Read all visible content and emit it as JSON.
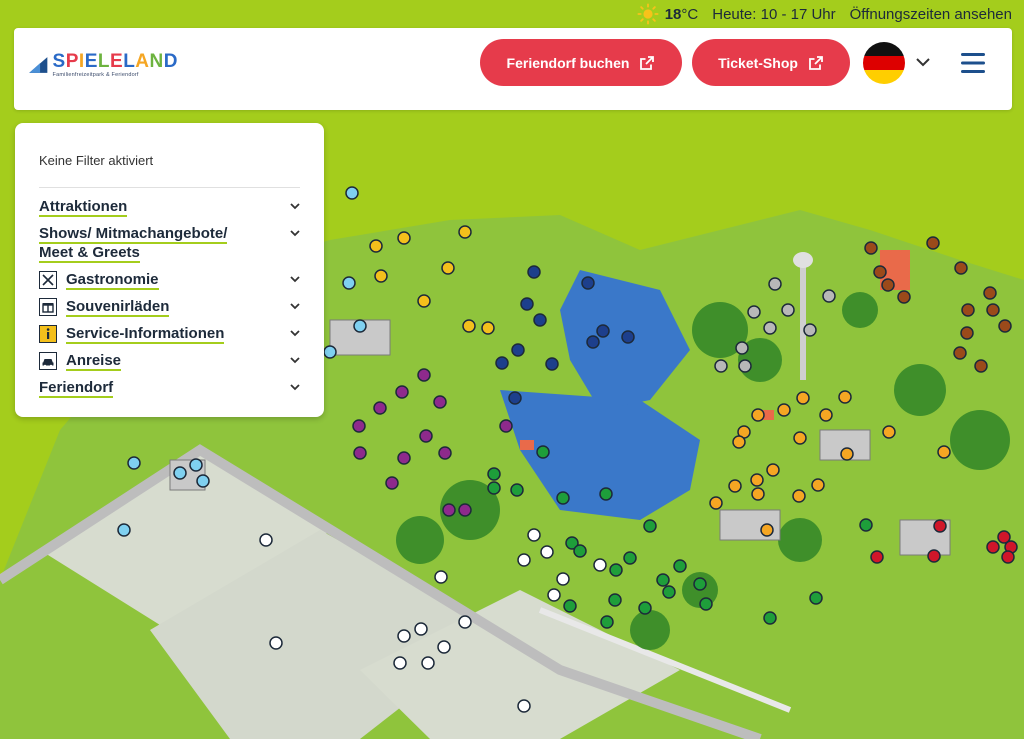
{
  "topbar": {
    "temperature": "18",
    "temperature_unit": "°C",
    "hours": "Heute: 10 - 17 Uhr",
    "hours_link": "Öffnungszeiten ansehen"
  },
  "header": {
    "logo_word": "SPIELELAND",
    "logo_sub": "Familienfreizeitpark & Feriendorf",
    "btn_feriendorf": "Feriendorf buchen",
    "btn_ticket": "Ticket-Shop",
    "language_icon": "flag-germany-icon",
    "colors": {
      "accent_red": "#e63b4b",
      "navy": "#1d4f8c",
      "lime": "#a4cd1c"
    }
  },
  "filter": {
    "status": "Keine Filter aktiviert",
    "items": [
      {
        "label": "Attraktionen",
        "icon": null
      },
      {
        "label": "Shows/ Mitmachangebote/",
        "label2": "Meet & Greets",
        "icon": null
      },
      {
        "label": "Gastronomie",
        "icon": "fork-knife-icon"
      },
      {
        "label": "Souvenirläden",
        "icon": "gift-icon"
      },
      {
        "label": "Service-Informationen",
        "icon": "info-icon"
      },
      {
        "label": "Anreise",
        "icon": "car-icon"
      },
      {
        "label": "Feriendorf",
        "icon": null
      }
    ]
  },
  "map": {
    "marker_colors": {
      "attraktionen_shows": "#f4c01c",
      "gastronomie": "#1e9e3a",
      "souvenir": "#8e2a8c",
      "service": "#1d3f8c",
      "anreise": "#ffffff",
      "feriendorf": "#7fd0f0",
      "extra_orange": "#f5a623",
      "extra_brown": "#9b4a1a",
      "extra_red": "#d0162a",
      "extra_gray": "#b8b8b8"
    }
  }
}
